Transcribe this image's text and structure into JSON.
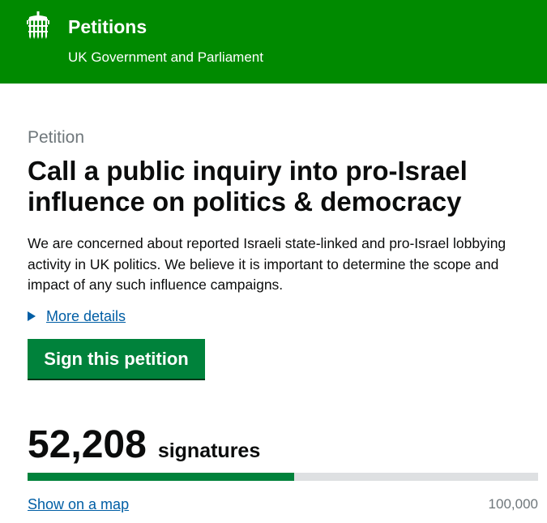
{
  "header": {
    "site_name": "Petitions",
    "site_subtitle": "UK Government and Parliament",
    "logo_icon": "portcullis-icon",
    "background_color": "#008a00"
  },
  "petition": {
    "caption": "Petition",
    "title": "Call a public inquiry into pro-Israel influence on politics & democracy",
    "summary": "We are concerned about reported Israeli state-linked and pro-Israel lobbying activity in UK politics. We believe it is important to determine the scope and impact of any such influence campaigns.",
    "more_details_label": "More details",
    "sign_button_label": "Sign this petition"
  },
  "signatures": {
    "count": "52,208",
    "label": "signatures",
    "threshold": "100,000",
    "progress_fraction": 0.52208,
    "show_map_label": "Show on a map"
  },
  "colors": {
    "brand_green": "#00823b",
    "link_blue": "#005ea5",
    "progress_track": "#dee0e2"
  }
}
